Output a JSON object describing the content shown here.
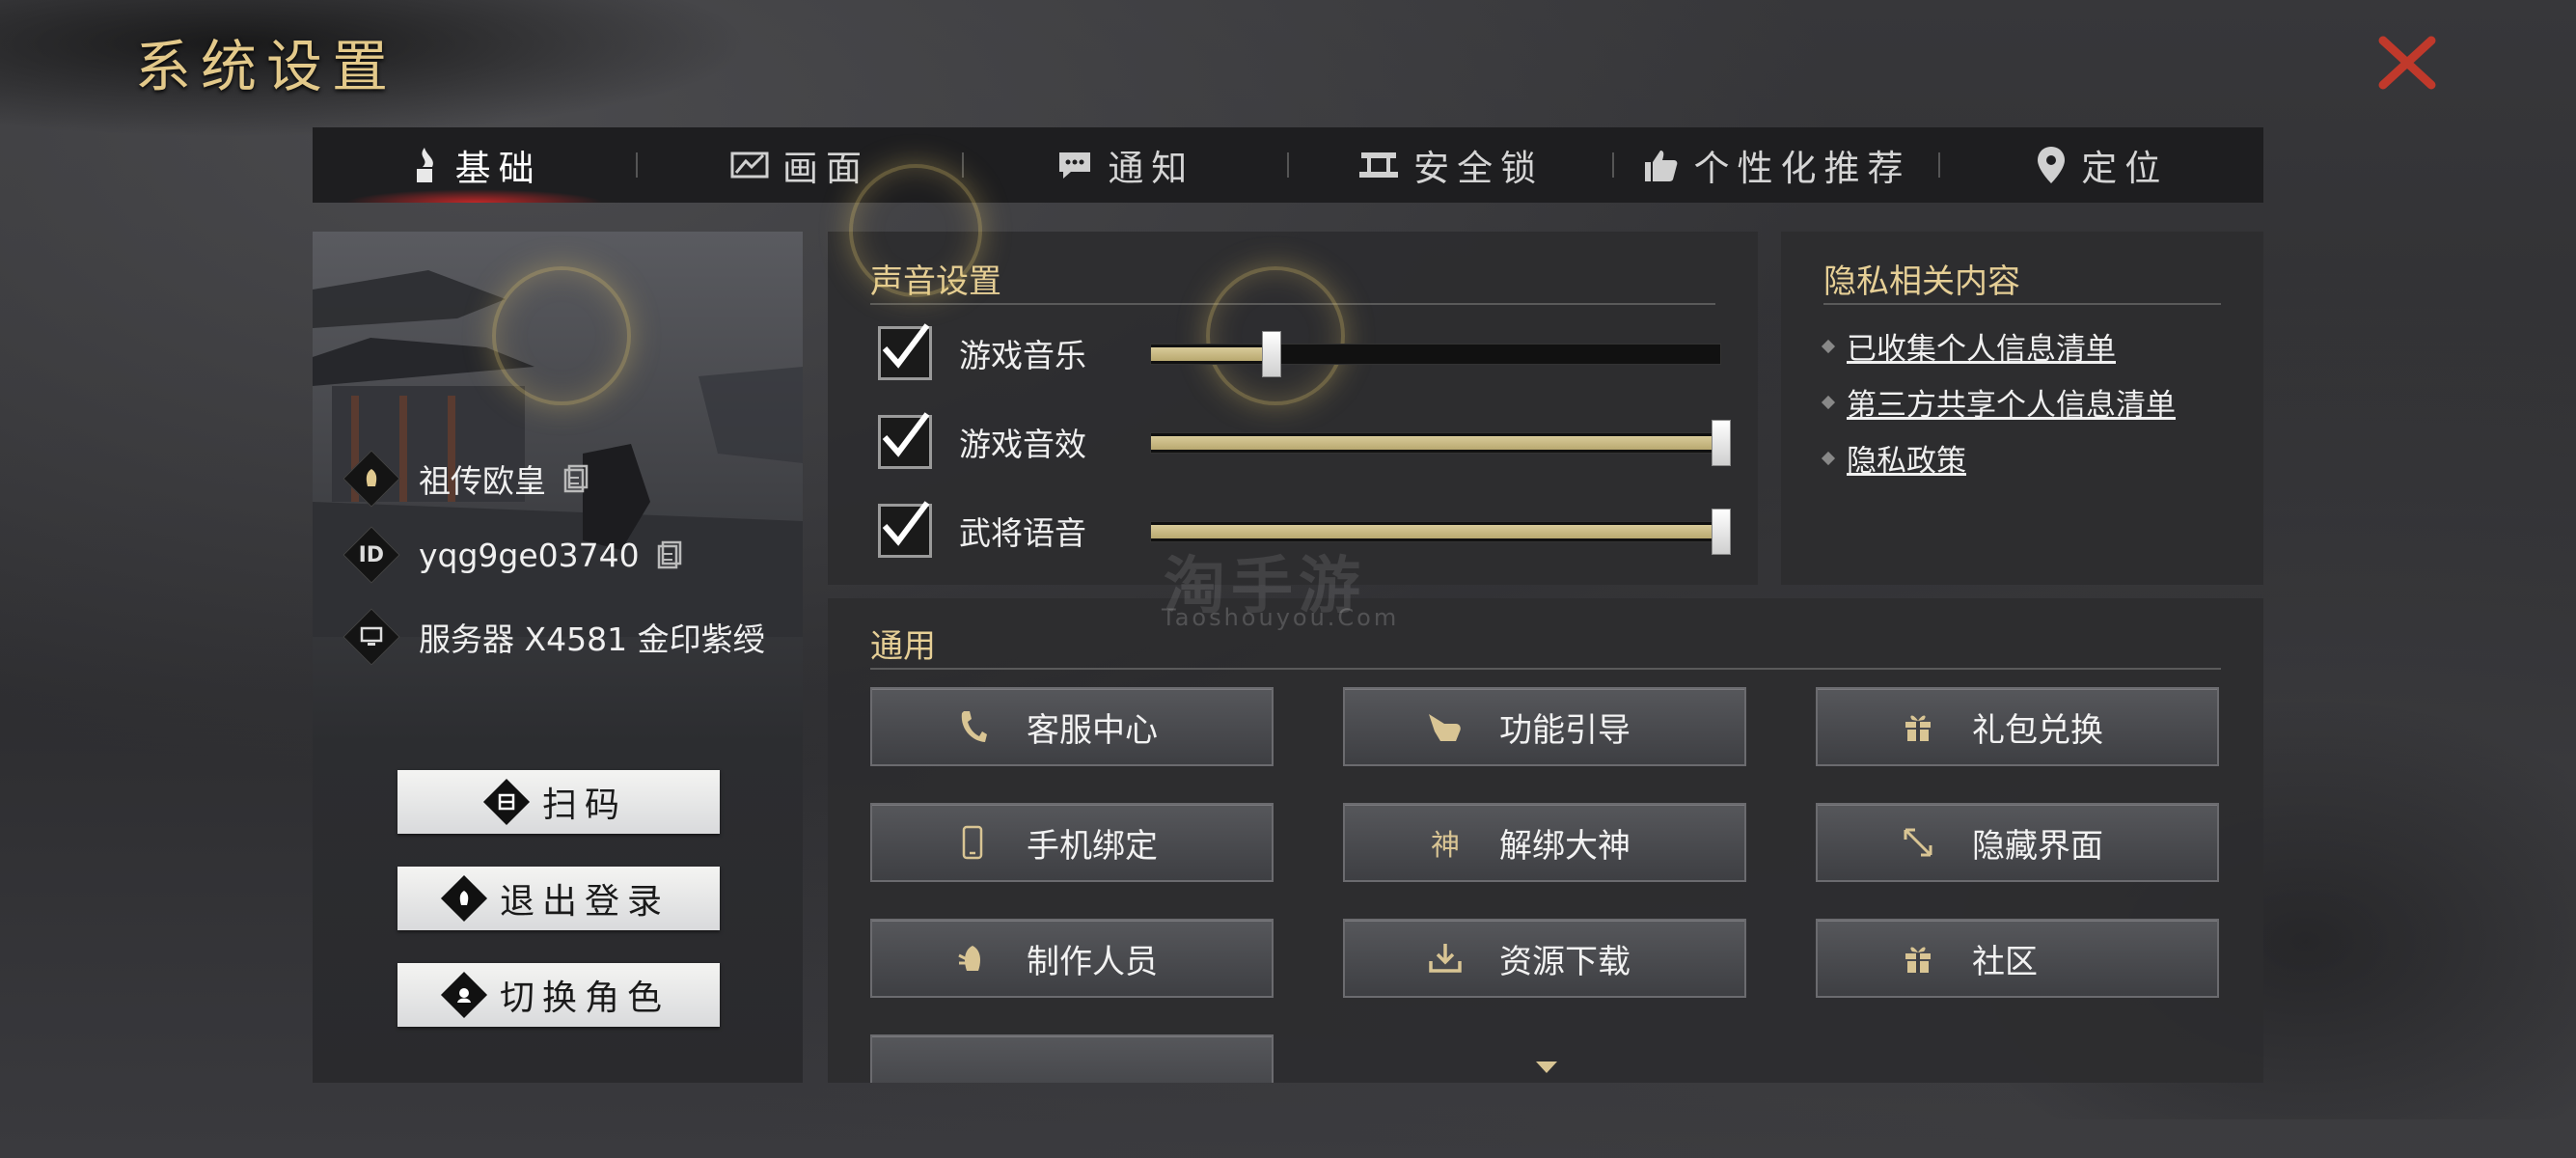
{
  "header": {
    "title": "系统设置"
  },
  "tabs": [
    {
      "label": "基础",
      "icon": "torch-icon",
      "active": true
    },
    {
      "label": "画面",
      "icon": "screen-icon",
      "active": false
    },
    {
      "label": "通知",
      "icon": "chat-bubble-icon",
      "active": false
    },
    {
      "label": "安全锁",
      "icon": "lock-icon",
      "active": false
    },
    {
      "label": "个性化推荐",
      "icon": "thumbs-up-icon",
      "active": false
    },
    {
      "label": "定位",
      "icon": "location-pin-icon",
      "active": false
    }
  ],
  "profile": {
    "name": "祖传欧皇",
    "id_badge": "ID",
    "id": "yqg9ge03740",
    "server": "服务器 X4581 金印紫绶",
    "buttons": {
      "scan": "扫码",
      "logout": "退出登录",
      "switch_role": "切换角色"
    }
  },
  "sound": {
    "title": "声音设置",
    "rows": [
      {
        "label": "游戏音乐",
        "checked": true,
        "level": 0.21
      },
      {
        "label": "游戏音效",
        "checked": true,
        "level": 1.0
      },
      {
        "label": "武将语音",
        "checked": true,
        "level": 1.0
      }
    ]
  },
  "privacy": {
    "title": "隐私相关内容",
    "links": [
      "已收集个人信息清单",
      "第三方共享个人信息清单",
      "隐私政策"
    ]
  },
  "general": {
    "title": "通用",
    "buttons": [
      {
        "label": "客服中心",
        "icon": "phone-icon"
      },
      {
        "label": "功能引导",
        "icon": "pointing-hand-icon"
      },
      {
        "label": "礼包兑换",
        "icon": "gift-icon"
      },
      {
        "label": "手机绑定",
        "icon": "mobile-icon"
      },
      {
        "label": "解绑大神",
        "icon": "shen-icon",
        "icon_text": "神"
      },
      {
        "label": "隐藏界面",
        "icon": "expand-arrows-icon"
      },
      {
        "label": "制作人员",
        "icon": "credits-icon"
      },
      {
        "label": "资源下载",
        "icon": "download-icon"
      },
      {
        "label": "社区",
        "icon": "gift-icon"
      }
    ]
  },
  "watermark": {
    "main": "淘手游",
    "sub": "Taoshouyou.Com"
  },
  "colors": {
    "gold": "#e6cf96",
    "accent_red": "#c0392b",
    "panel": "#2c2c2f"
  }
}
